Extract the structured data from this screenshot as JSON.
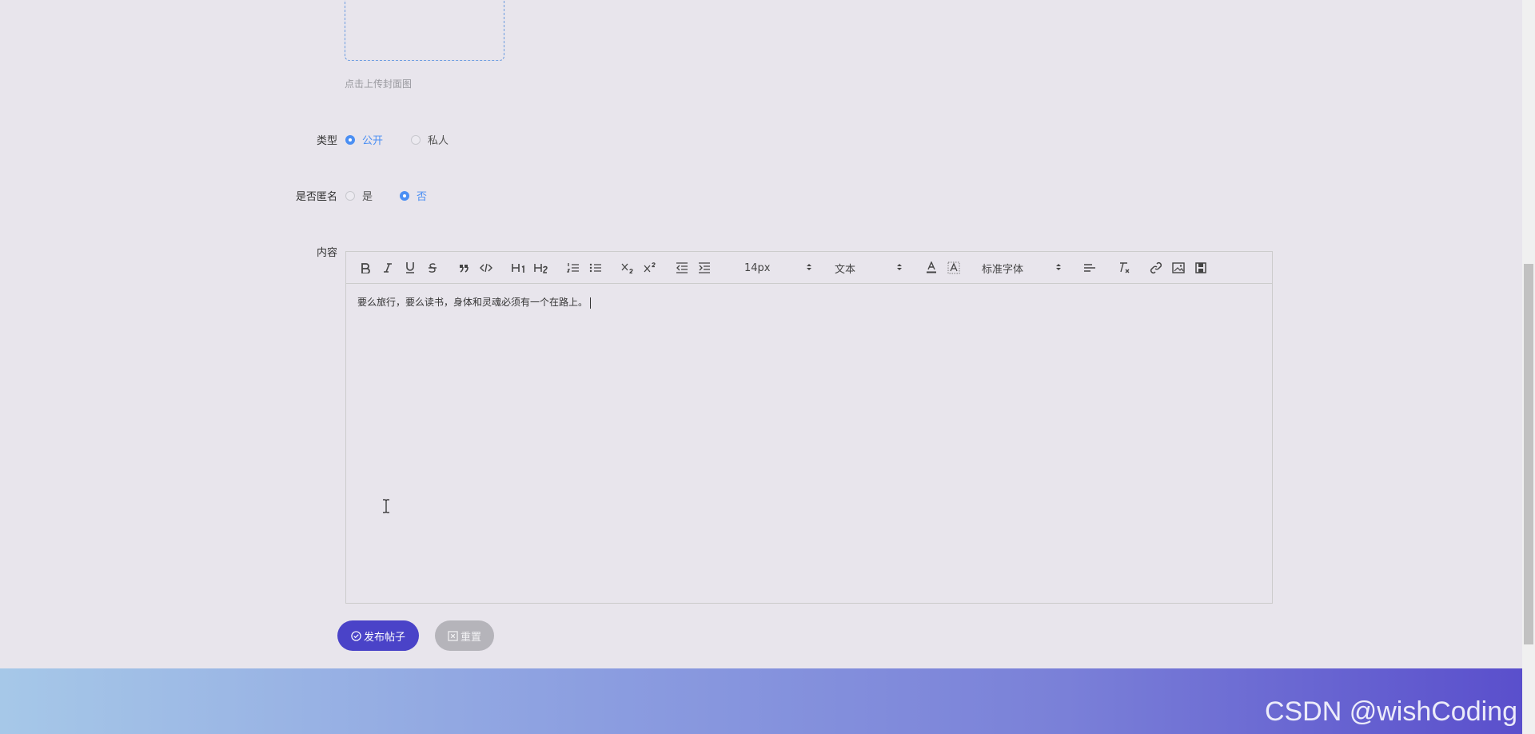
{
  "cover": {
    "hint": "点击上传封面图"
  },
  "type_field": {
    "label": "类型",
    "options": [
      {
        "label": "公开",
        "checked": true
      },
      {
        "label": "私人",
        "checked": false
      }
    ]
  },
  "anonymous_field": {
    "label": "是否匿名",
    "options": [
      {
        "label": "是",
        "checked": false
      },
      {
        "label": "否",
        "checked": true
      }
    ]
  },
  "content_field": {
    "label": "内容",
    "toolbar": {
      "size_value": "14px",
      "header_value": "文本",
      "font_value": "标准字体",
      "icons": [
        "bold-icon",
        "italic-icon",
        "underline-icon",
        "strike-icon",
        "blockquote-icon",
        "code-block-icon",
        "h1-icon",
        "h2-icon",
        "ordered-list-icon",
        "bullet-list-icon",
        "subscript-icon",
        "superscript-icon",
        "outdent-icon",
        "indent-icon",
        "font-color-icon",
        "background-color-icon",
        "align-icon",
        "clean-format-icon",
        "link-icon",
        "image-icon",
        "video-icon"
      ]
    },
    "text": "要么旅行，要么读书，身体和灵魂必须有一个在路上。"
  },
  "actions": {
    "publish_label": "发布帖子",
    "reset_label": "重置"
  },
  "watermark": "CSDN @wishCoding",
  "colors": {
    "accent": "#4b8ff3",
    "publish": "#4a43c8",
    "reset": "#b5b4ba"
  }
}
